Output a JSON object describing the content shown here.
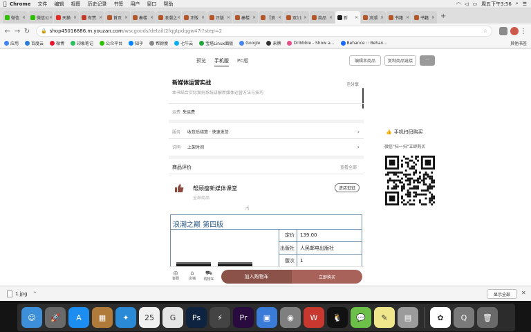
{
  "menubar": {
    "app": "Chrome",
    "items": [
      "文件",
      "编辑",
      "视图",
      "历史记录",
      "书签",
      "用户",
      "窗口",
      "帮助"
    ],
    "clock": "周五下午3:56"
  },
  "tabs": [
    {
      "label": "微信",
      "color": "#2dc100"
    },
    {
      "label": "微信公",
      "color": "#2dc100"
    },
    {
      "label": "天猫",
      "color": "#e02e24"
    },
    {
      "label": "有赞",
      "color": "#c23a2b"
    },
    {
      "label": "首页",
      "color": "#b5552a"
    },
    {
      "label": "秦楼",
      "color": "#b5552a"
    },
    {
      "label": "浪潮之",
      "color": "#b5552a"
    },
    {
      "label": "正版",
      "color": "#b5552a"
    },
    {
      "label": "正版",
      "color": "#b5552a"
    },
    {
      "label": "秦楼",
      "color": "#b5552a"
    },
    {
      "label": "【浪",
      "color": "#b5552a"
    },
    {
      "label": "双11",
      "color": "#b5552a"
    },
    {
      "label": "商品",
      "color": "#b5552a"
    },
    {
      "label": "新",
      "color": "#1d1d1d"
    },
    {
      "label": "浪潮",
      "color": "#b5552a"
    },
    {
      "label": "书籍",
      "color": "#b5552a"
    },
    {
      "label": "书籍",
      "color": "#b5552a"
    }
  ],
  "address": {
    "host": "shop45016886.m.youzan.com",
    "path": "/wscgoods/detail/2fqgtpdqgw47i?step=2"
  },
  "bookmarks": [
    {
      "label": "应用",
      "color": "#4285f4"
    },
    {
      "label": "百度云",
      "color": "#2e7bd6"
    },
    {
      "label": "微博",
      "color": "#e6162d"
    },
    {
      "label": "印象笔记",
      "color": "#2dbe60"
    },
    {
      "label": "公众平台",
      "color": "#2dc100"
    },
    {
      "label": "知乎",
      "color": "#0084ff"
    },
    {
      "label": "帮顾瘦",
      "color": "#888888"
    },
    {
      "label": "七牛云",
      "color": "#06aeef"
    },
    {
      "label": "宝塔Linux面板",
      "color": "#20a53a"
    },
    {
      "label": "Google",
      "color": "#4285f4"
    },
    {
      "label": "来牌",
      "color": "#333333"
    },
    {
      "label": "Dribbble - Show a...",
      "color": "#ea4c89"
    },
    {
      "label": "Behance :: Behan...",
      "color": "#1769ff"
    }
  ],
  "bookmarks_other": "其他书签",
  "page": {
    "preview_tabs": [
      "预览",
      "手机版",
      "PC版"
    ],
    "btn_edit": "编辑本商品",
    "btn_copy": "复制商品链接",
    "btn_more": "···"
  },
  "product": {
    "title": "新媒体运营实战",
    "desc": "本书结合实际案例系统讲解新媒体运营方法与技巧",
    "share": "分享",
    "ship_label": "运费",
    "ship_value": "免运费",
    "service_label": "服务",
    "service_value": "收货后结算 · 快速发货",
    "time_label": "说明",
    "time_value": "上架时间",
    "reviews_title": "商品评价",
    "reviews_more": "查看全部",
    "shop_name": "帮顾瘦新媒体课堂",
    "shop_sub": "全部商品",
    "enter_shop": "进店逛逛"
  },
  "book": {
    "title": "浪潮之巅 第四版",
    "rows": [
      {
        "k": "定价",
        "v": "139.00"
      },
      {
        "k": "出版社",
        "v": "人民邮电出版社"
      },
      {
        "k": "版次",
        "v": "1"
      }
    ]
  },
  "actionbar": {
    "icons": [
      {
        "label": "客服",
        "glyph": "◎"
      },
      {
        "label": "店铺",
        "glyph": "⌂"
      },
      {
        "label": "购物车",
        "glyph": "⛟"
      }
    ],
    "add_cart": "加入购物车",
    "buy_now": "立即购买"
  },
  "qr": {
    "title": "手机扫码购买",
    "subtitle": "微信\"扫一扫\"立即购买"
  },
  "downloads": {
    "file": "1.jpg",
    "show_all": "显示全部"
  },
  "dock": [
    {
      "name": "finder-icon",
      "color": "#3d8fd9",
      "glyph": "☺"
    },
    {
      "name": "launchpad-icon",
      "color": "#6a6a6a",
      "glyph": "🚀"
    },
    {
      "name": "app-store-icon",
      "color": "#1c8ef2",
      "glyph": "A"
    },
    {
      "name": "preview-icon",
      "color": "#b07a3a",
      "glyph": "▦"
    },
    {
      "name": "safari-icon",
      "color": "#2a8ad6",
      "glyph": "✦"
    },
    {
      "name": "calendar-icon",
      "color": "#f0f0f0",
      "glyph": "25"
    },
    {
      "name": "chrome-like-icon",
      "color": "#e6e6e6",
      "glyph": "G"
    },
    {
      "name": "photoshop-icon",
      "color": "#0e2340",
      "glyph": "Ps"
    },
    {
      "name": "gap-icon",
      "color": "#444444",
      "glyph": "⚡"
    },
    {
      "name": "premiere-icon",
      "color": "#2a0b3f",
      "glyph": "Pr"
    },
    {
      "name": "keynote-icon",
      "color": "#3b7bd8",
      "glyph": "▣"
    },
    {
      "name": "capture-icon",
      "color": "#7f7f7f",
      "glyph": "◉"
    },
    {
      "name": "wps-icon",
      "color": "#c8382e",
      "glyph": "W"
    },
    {
      "name": "qq-icon",
      "color": "#111111",
      "glyph": "🐧"
    },
    {
      "name": "wechat-icon",
      "color": "#6cc04a",
      "glyph": "💬"
    },
    {
      "name": "notes-icon",
      "color": "#f0e68c",
      "glyph": "✎"
    },
    {
      "name": "network-icon",
      "color": "#9b9b9b",
      "glyph": "▤"
    },
    {
      "name": "baidu-disk-icon",
      "color": "#ffffff",
      "glyph": "✿"
    },
    {
      "name": "quicktime-icon",
      "color": "#7a7a7a",
      "glyph": "Q"
    },
    {
      "name": "trash-icon",
      "color": "#6a6a6a",
      "glyph": "🗑"
    }
  ]
}
